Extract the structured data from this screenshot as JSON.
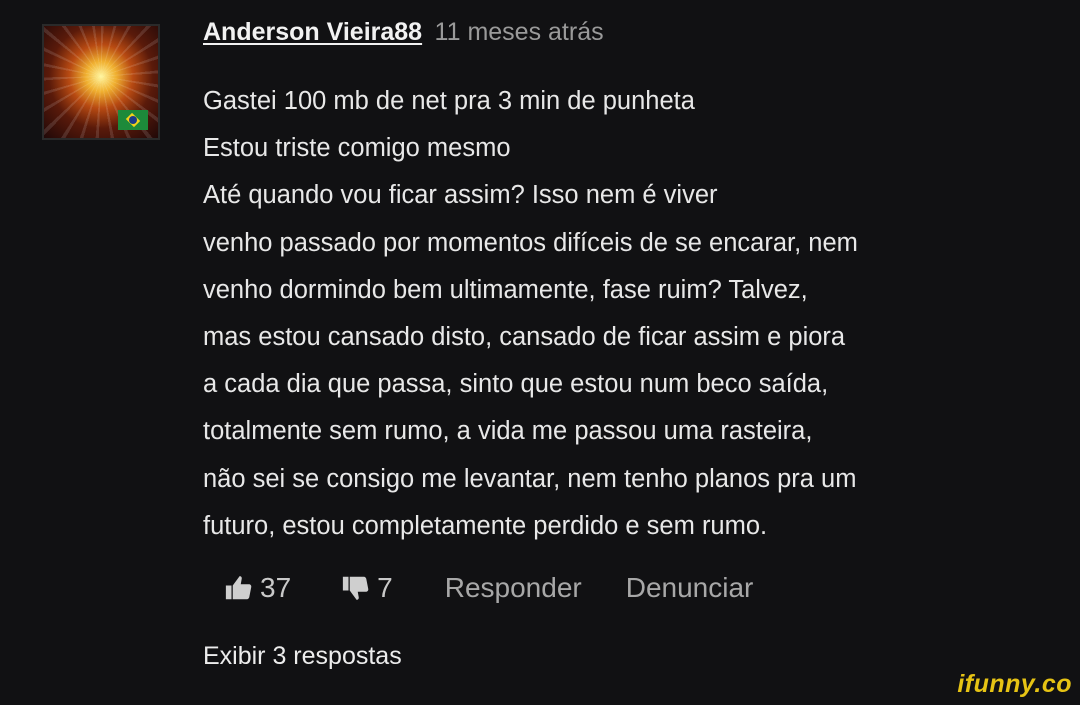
{
  "comment": {
    "author": "Anderson Vieira88",
    "timestamp": "11 meses atrás",
    "avatar_icon": "glowing-head-avatar",
    "flag_icon": "brazil-flag-icon",
    "lines": [
      "Gastei 100 mb de net pra 3 min de punheta",
      "Estou triste comigo mesmo",
      "Até quando vou ficar assim? Isso nem é viver",
      "venho passado por momentos difíceis de se encarar, nem",
      "venho dormindo bem ultimamente, fase ruim? Talvez,",
      "mas estou cansado disto, cansado de ficar assim e piora",
      "a cada dia que passa, sinto que estou num beco saída,",
      "totalmente sem rumo, a vida me passou uma rasteira,",
      "não sei se consigo me levantar, nem tenho planos pra um",
      "futuro, estou completamente perdido e sem rumo."
    ],
    "likes": "37",
    "dislikes": "7",
    "reply_label": "Responder",
    "report_label": "Denunciar",
    "view_replies_label": "Exibir 3 respostas"
  },
  "watermark": "ifunny.co",
  "colors": {
    "background": "#111113",
    "text": "#e8e8e8",
    "muted": "#9a9a9a",
    "watermark": "#e6c314"
  }
}
